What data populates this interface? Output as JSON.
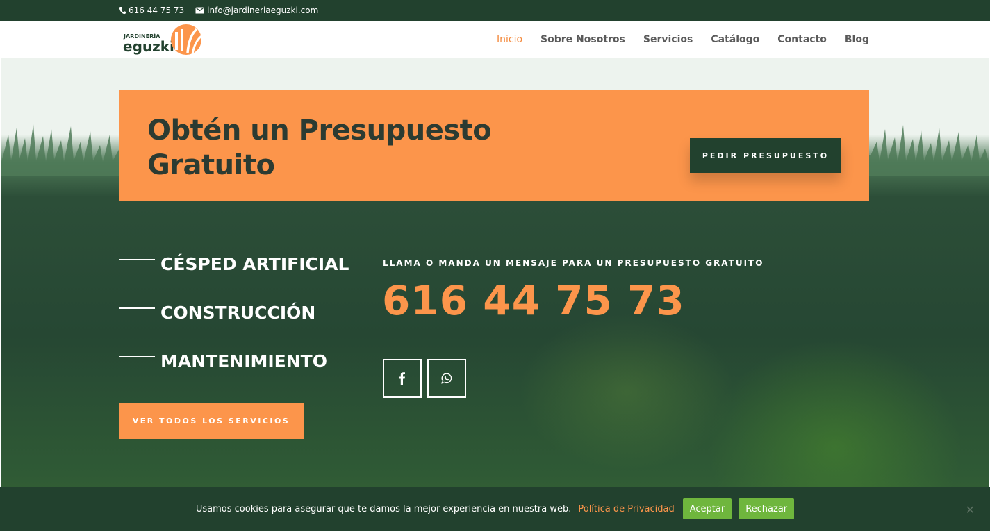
{
  "topbar": {
    "phone": "616 44 75 73",
    "email": "info@jardineriaeguzki.com"
  },
  "logo": {
    "small_text": "JARDINERÍA",
    "big_text": "eguzki"
  },
  "nav": {
    "items": [
      {
        "label": "Inicio",
        "active": true
      },
      {
        "label": "Sobre Nosotros"
      },
      {
        "label": "Servicios"
      },
      {
        "label": "Catálogo"
      },
      {
        "label": "Contacto"
      },
      {
        "label": "Blog"
      }
    ]
  },
  "cta": {
    "title": "Obtén un Presupuesto Gratuito",
    "button_label": "PEDIR PRESUPUESTO"
  },
  "services": {
    "items": [
      "CÉSPED ARTIFICIAL",
      "CONSTRUCCIÓN",
      "MANTENIMIENTO"
    ],
    "button_label": "VER TODOS LOS SERVICIOS"
  },
  "contact": {
    "label": "LLAMA O MANDA UN MENSAJE PARA UN PRESUPUESTO GRATUITO",
    "phone": "616 44 75 73",
    "social": [
      "facebook-icon",
      "whatsapp-icon"
    ]
  },
  "cookie": {
    "message": "Usamos cookies para asegurar que te damos la mejor experiencia en nuestra web.",
    "policy_link": "Política de Privacidad",
    "accept": "Aceptar",
    "reject": "Rechazar",
    "close": "✕"
  },
  "colors": {
    "dark_green": "#22412e",
    "orange": "#fc954b",
    "accept_green": "#6fb63d",
    "nav_active": "#f48a3d"
  }
}
